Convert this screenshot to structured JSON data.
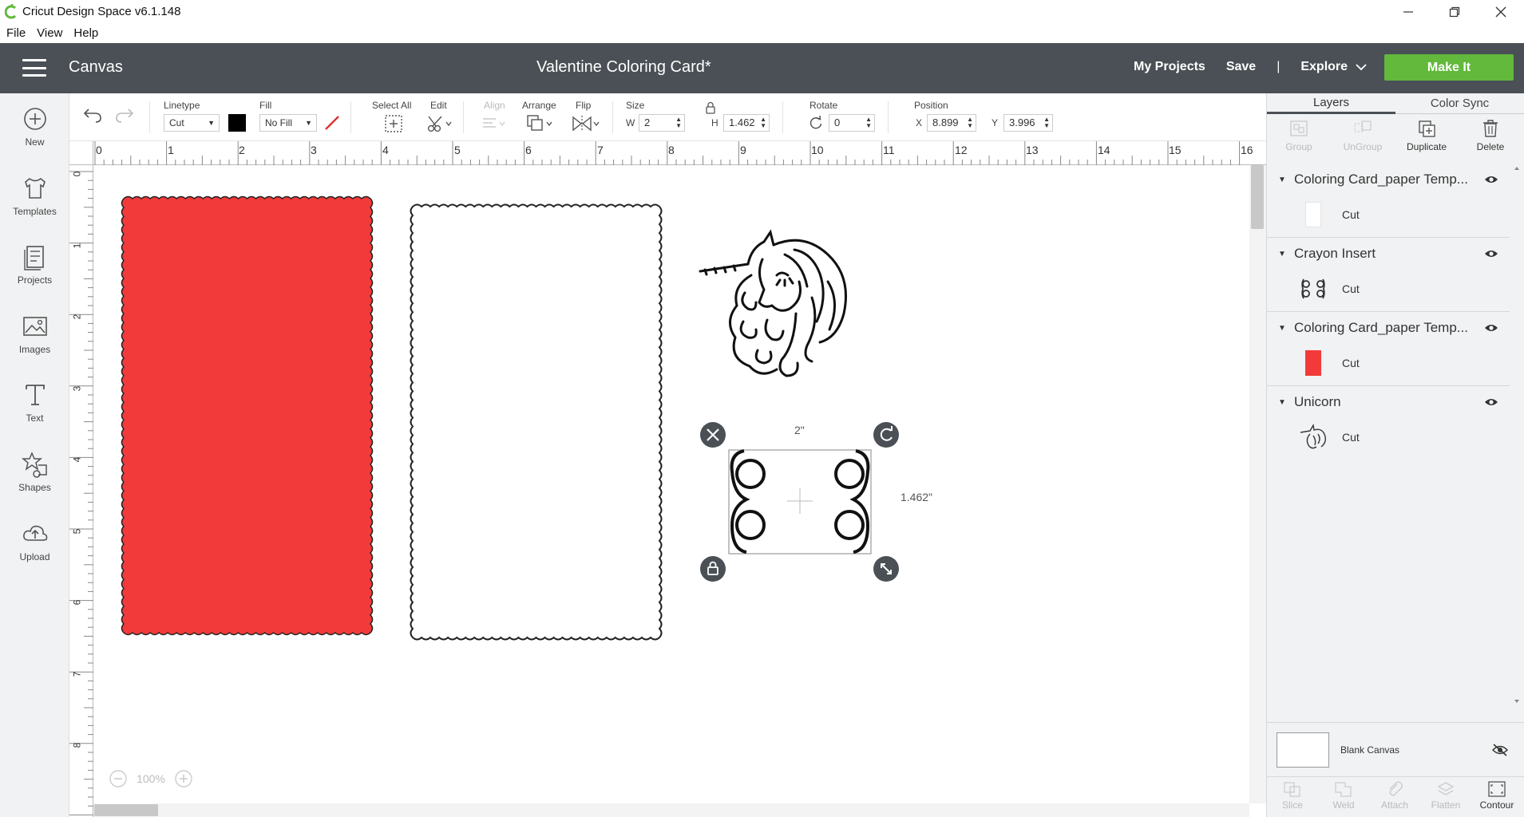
{
  "window": {
    "app_title": "Cricut Design Space  v6.1.148",
    "icons": [
      "cricut-logo-icon",
      "minimize-icon",
      "restore-icon",
      "close-icon"
    ]
  },
  "menubar": {
    "items": [
      "File",
      "View",
      "Help"
    ]
  },
  "header": {
    "section": "Canvas",
    "project_title": "Valentine Coloring Card*",
    "nav": {
      "my_projects": "My Projects",
      "save": "Save",
      "separator": "|",
      "explore": "Explore"
    },
    "make_it": "Make It",
    "colors": {
      "bar": "#4a5055",
      "make_it": "#62b93b"
    }
  },
  "sidebar": {
    "items": [
      {
        "label": "New",
        "icon": "plus-circle-icon"
      },
      {
        "label": "Templates",
        "icon": "tshirt-icon"
      },
      {
        "label": "Projects",
        "icon": "projects-icon"
      },
      {
        "label": "Images",
        "icon": "image-icon"
      },
      {
        "label": "Text",
        "icon": "text-icon"
      },
      {
        "label": "Shapes",
        "icon": "shapes-icon"
      },
      {
        "label": "Upload",
        "icon": "upload-cloud-icon"
      }
    ]
  },
  "toolbar": {
    "linetype": {
      "label": "Linetype",
      "value": "Cut",
      "color": "#000000"
    },
    "fill": {
      "label": "Fill",
      "value": "No Fill"
    },
    "select_all": "Select All",
    "edit": "Edit",
    "align": "Align",
    "arrange": "Arrange",
    "flip": "Flip",
    "size": {
      "label": "Size",
      "w_label": "W",
      "w": "2",
      "h_label": "H",
      "h": "1.462"
    },
    "rotate": {
      "label": "Rotate",
      "value": "0"
    },
    "position": {
      "label": "Position",
      "x_label": "X",
      "x": "8.899",
      "y_label": "Y",
      "y": "3.996"
    }
  },
  "ruler": {
    "top": [
      "0",
      "1",
      "2",
      "3",
      "4",
      "5",
      "6",
      "7",
      "8",
      "9",
      "10",
      "11",
      "12",
      "13",
      "14",
      "15",
      "16"
    ],
    "left": [
      "0",
      "1",
      "2",
      "3",
      "4",
      "5",
      "6",
      "7",
      "8"
    ]
  },
  "canvas": {
    "selection": {
      "width_label": "2\"",
      "height_label": "1.462\""
    },
    "zoom": "100%",
    "colors": {
      "card_red": "#f23a3a"
    }
  },
  "right_panel": {
    "tabs": {
      "layers": "Layers",
      "color_sync": "Color Sync"
    },
    "actions": {
      "group": "Group",
      "ungroup": "UnGroup",
      "duplicate": "Duplicate",
      "delete": "Delete"
    },
    "layers": [
      {
        "name": "Coloring Card_paper Temp...",
        "child": "Cut",
        "thumb": "white"
      },
      {
        "name": "Crayon Insert",
        "child": "Cut",
        "thumb": "crayon"
      },
      {
        "name": "Coloring Card_paper Temp...",
        "child": "Cut",
        "thumb": "red"
      },
      {
        "name": "Unicorn",
        "child": "Cut",
        "thumb": "unicorn"
      }
    ],
    "blank_canvas": "Blank Canvas",
    "bottom_actions": {
      "slice": "Slice",
      "weld": "Weld",
      "attach": "Attach",
      "flatten": "Flatten",
      "contour": "Contour"
    }
  }
}
